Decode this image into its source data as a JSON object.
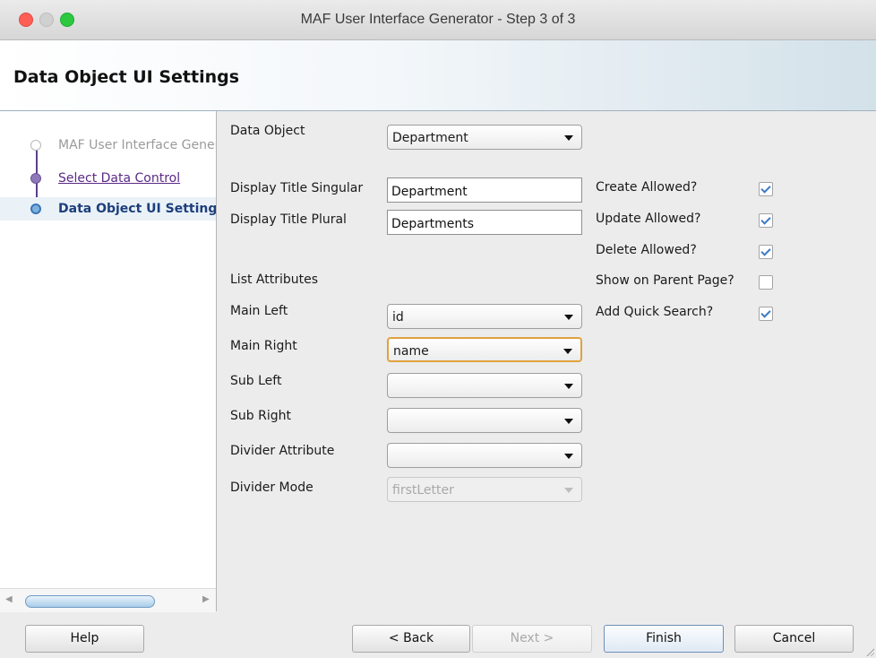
{
  "window": {
    "title": "MAF User Interface Generator - Step 3 of 3"
  },
  "header": {
    "title": "Data Object UI Settings"
  },
  "nav": {
    "items": [
      {
        "label": "MAF User Interface Generator",
        "state": "inactive"
      },
      {
        "label": "Select Data Control",
        "state": "visited"
      },
      {
        "label": "Data Object UI Settings",
        "state": "current"
      }
    ]
  },
  "form": {
    "data_object": {
      "label": "Data Object",
      "value": "Department"
    },
    "title_singular": {
      "label": "Display Title Singular",
      "value": "Department"
    },
    "title_plural": {
      "label": "Display Title Plural",
      "value": "Departments"
    },
    "list_attributes_heading": "List Attributes",
    "main_left": {
      "label": "Main Left",
      "value": "id"
    },
    "main_right": {
      "label": "Main Right",
      "value": "name"
    },
    "sub_left": {
      "label": "Sub Left",
      "value": ""
    },
    "sub_right": {
      "label": "Sub Right",
      "value": ""
    },
    "divider_attribute": {
      "label": "Divider Attribute",
      "value": ""
    },
    "divider_mode": {
      "label": "Divider Mode",
      "value": "firstLetter",
      "disabled": true
    }
  },
  "options": {
    "create_allowed": {
      "label": "Create Allowed?",
      "checked": true
    },
    "update_allowed": {
      "label": "Update Allowed?",
      "checked": true
    },
    "delete_allowed": {
      "label": "Delete Allowed?",
      "checked": true
    },
    "show_on_parent": {
      "label": "Show on Parent Page?",
      "checked": false
    },
    "add_quick_search": {
      "label": "Add Quick Search?",
      "checked": true
    }
  },
  "buttons": {
    "help": "Help",
    "back": "< Back",
    "next": "Next >",
    "finish": "Finish",
    "cancel": "Cancel"
  },
  "colors": {
    "nav_current": "#1d3e7c",
    "nav_visited": "#5b2a86",
    "checkbox_check": "#3b79c9",
    "focus_ring": "#e0a23f"
  }
}
